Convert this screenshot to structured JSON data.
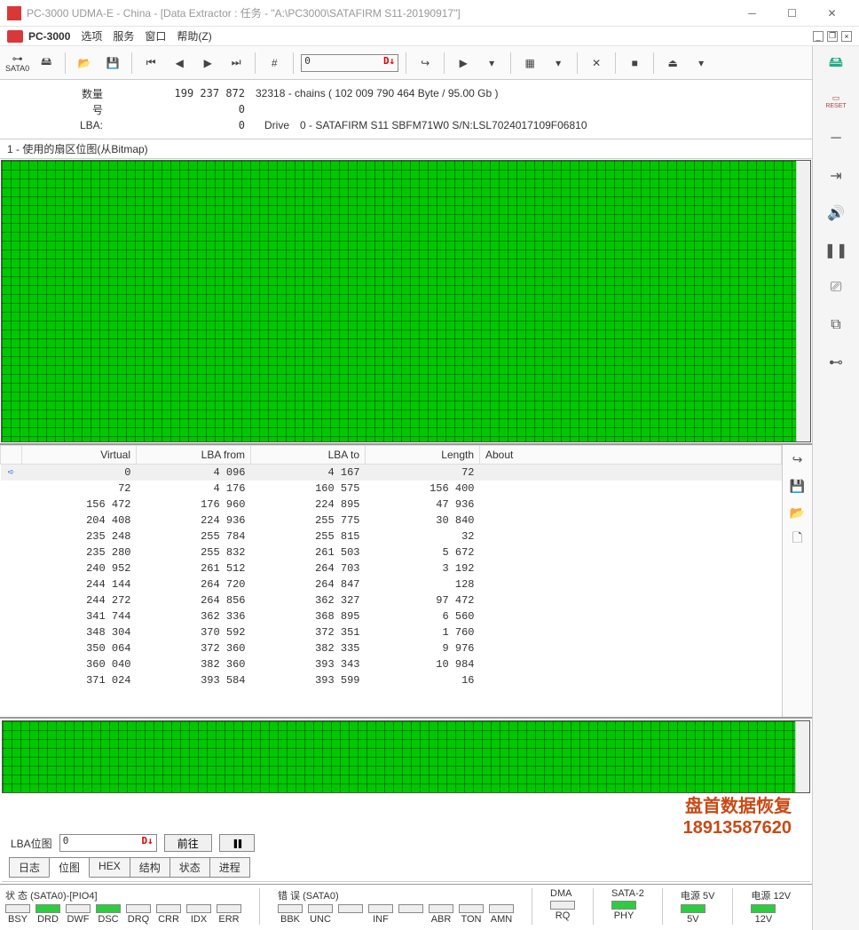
{
  "title": "PC-3000 UDMA-E - China - [Data Extractor : 任务 - \"A:\\PC3000\\SATAFIRM   S11-20190917\"]",
  "brand": "PC-3000",
  "menu": {
    "opt": "选项",
    "svc": "服务",
    "win": "窗口",
    "help": "帮助(Z)"
  },
  "sata_port": "SATA0",
  "lba_toolbar": "0",
  "info": {
    "qty_label": "数量",
    "qty_value": "199 237 872",
    "chains": "32318 - chains  ( 102 009 790 464 Byte /  95.00 Gb )",
    "hao_label": "号",
    "hao_value": "0",
    "lba_label": "LBA:",
    "lba_value": "0",
    "drive_label": "Drive",
    "drive_value": "0 - SATAFIRM   S11 SBFM71W0 S/N:LSL7024017109F06810"
  },
  "section_title": "1 - 使用的扇区位图(从Bitmap)",
  "columns": {
    "virtual": "Virtual",
    "lba_from": "LBA from",
    "lba_to": "LBA to",
    "length": "Length",
    "about": "About"
  },
  "rows": [
    {
      "v": "0",
      "f": "4 096",
      "t": "4 167",
      "l": "72"
    },
    {
      "v": "72",
      "f": "4 176",
      "t": "160 575",
      "l": "156 400"
    },
    {
      "v": "156 472",
      "f": "176 960",
      "t": "224 895",
      "l": "47 936"
    },
    {
      "v": "204 408",
      "f": "224 936",
      "t": "255 775",
      "l": "30 840"
    },
    {
      "v": "235 248",
      "f": "255 784",
      "t": "255 815",
      "l": "32"
    },
    {
      "v": "235 280",
      "f": "255 832",
      "t": "261 503",
      "l": "5 672"
    },
    {
      "v": "240 952",
      "f": "261 512",
      "t": "264 703",
      "l": "3 192"
    },
    {
      "v": "244 144",
      "f": "264 720",
      "t": "264 847",
      "l": "128"
    },
    {
      "v": "244 272",
      "f": "264 856",
      "t": "362 327",
      "l": "97 472"
    },
    {
      "v": "341 744",
      "f": "362 336",
      "t": "368 895",
      "l": "6 560"
    },
    {
      "v": "348 304",
      "f": "370 592",
      "t": "372 351",
      "l": "1 760"
    },
    {
      "v": "350 064",
      "f": "372 360",
      "t": "382 335",
      "l": "9 976"
    },
    {
      "v": "360 040",
      "f": "382 360",
      "t": "393 343",
      "l": "10 984"
    },
    {
      "v": "371 024",
      "f": "393 584",
      "t": "393 599",
      "l": "16"
    }
  ],
  "nav": {
    "label": "LBA位图",
    "value": "0",
    "go": "前往",
    "pause": "❚❚"
  },
  "tabs": {
    "log": "日志",
    "bitmap": "位图",
    "hex": "HEX",
    "struct": "结构",
    "state": "状态",
    "proc": "进程"
  },
  "status": {
    "group1": "状 态 (SATA0)-[PIO4]",
    "group2": "错 误 (SATA0)",
    "dma": "DMA",
    "sata2": "SATA-2",
    "pwr5": "电源 5V",
    "pwr12": "电源 12V",
    "leds1": [
      "BSY",
      "DRD",
      "DWF",
      "DSC",
      "DRQ",
      "CRR",
      "IDX",
      "ERR"
    ],
    "leds2": [
      "BBK",
      "UNC",
      "",
      "INF",
      "",
      "ABR",
      "TON",
      "AMN"
    ],
    "rq": "RQ",
    "phy": "PHY",
    "v5": "5V",
    "v12": "12V"
  },
  "watermark": {
    "l1": "盘首数据恢复",
    "l2": "18913587620"
  },
  "reset_label": "RESET"
}
